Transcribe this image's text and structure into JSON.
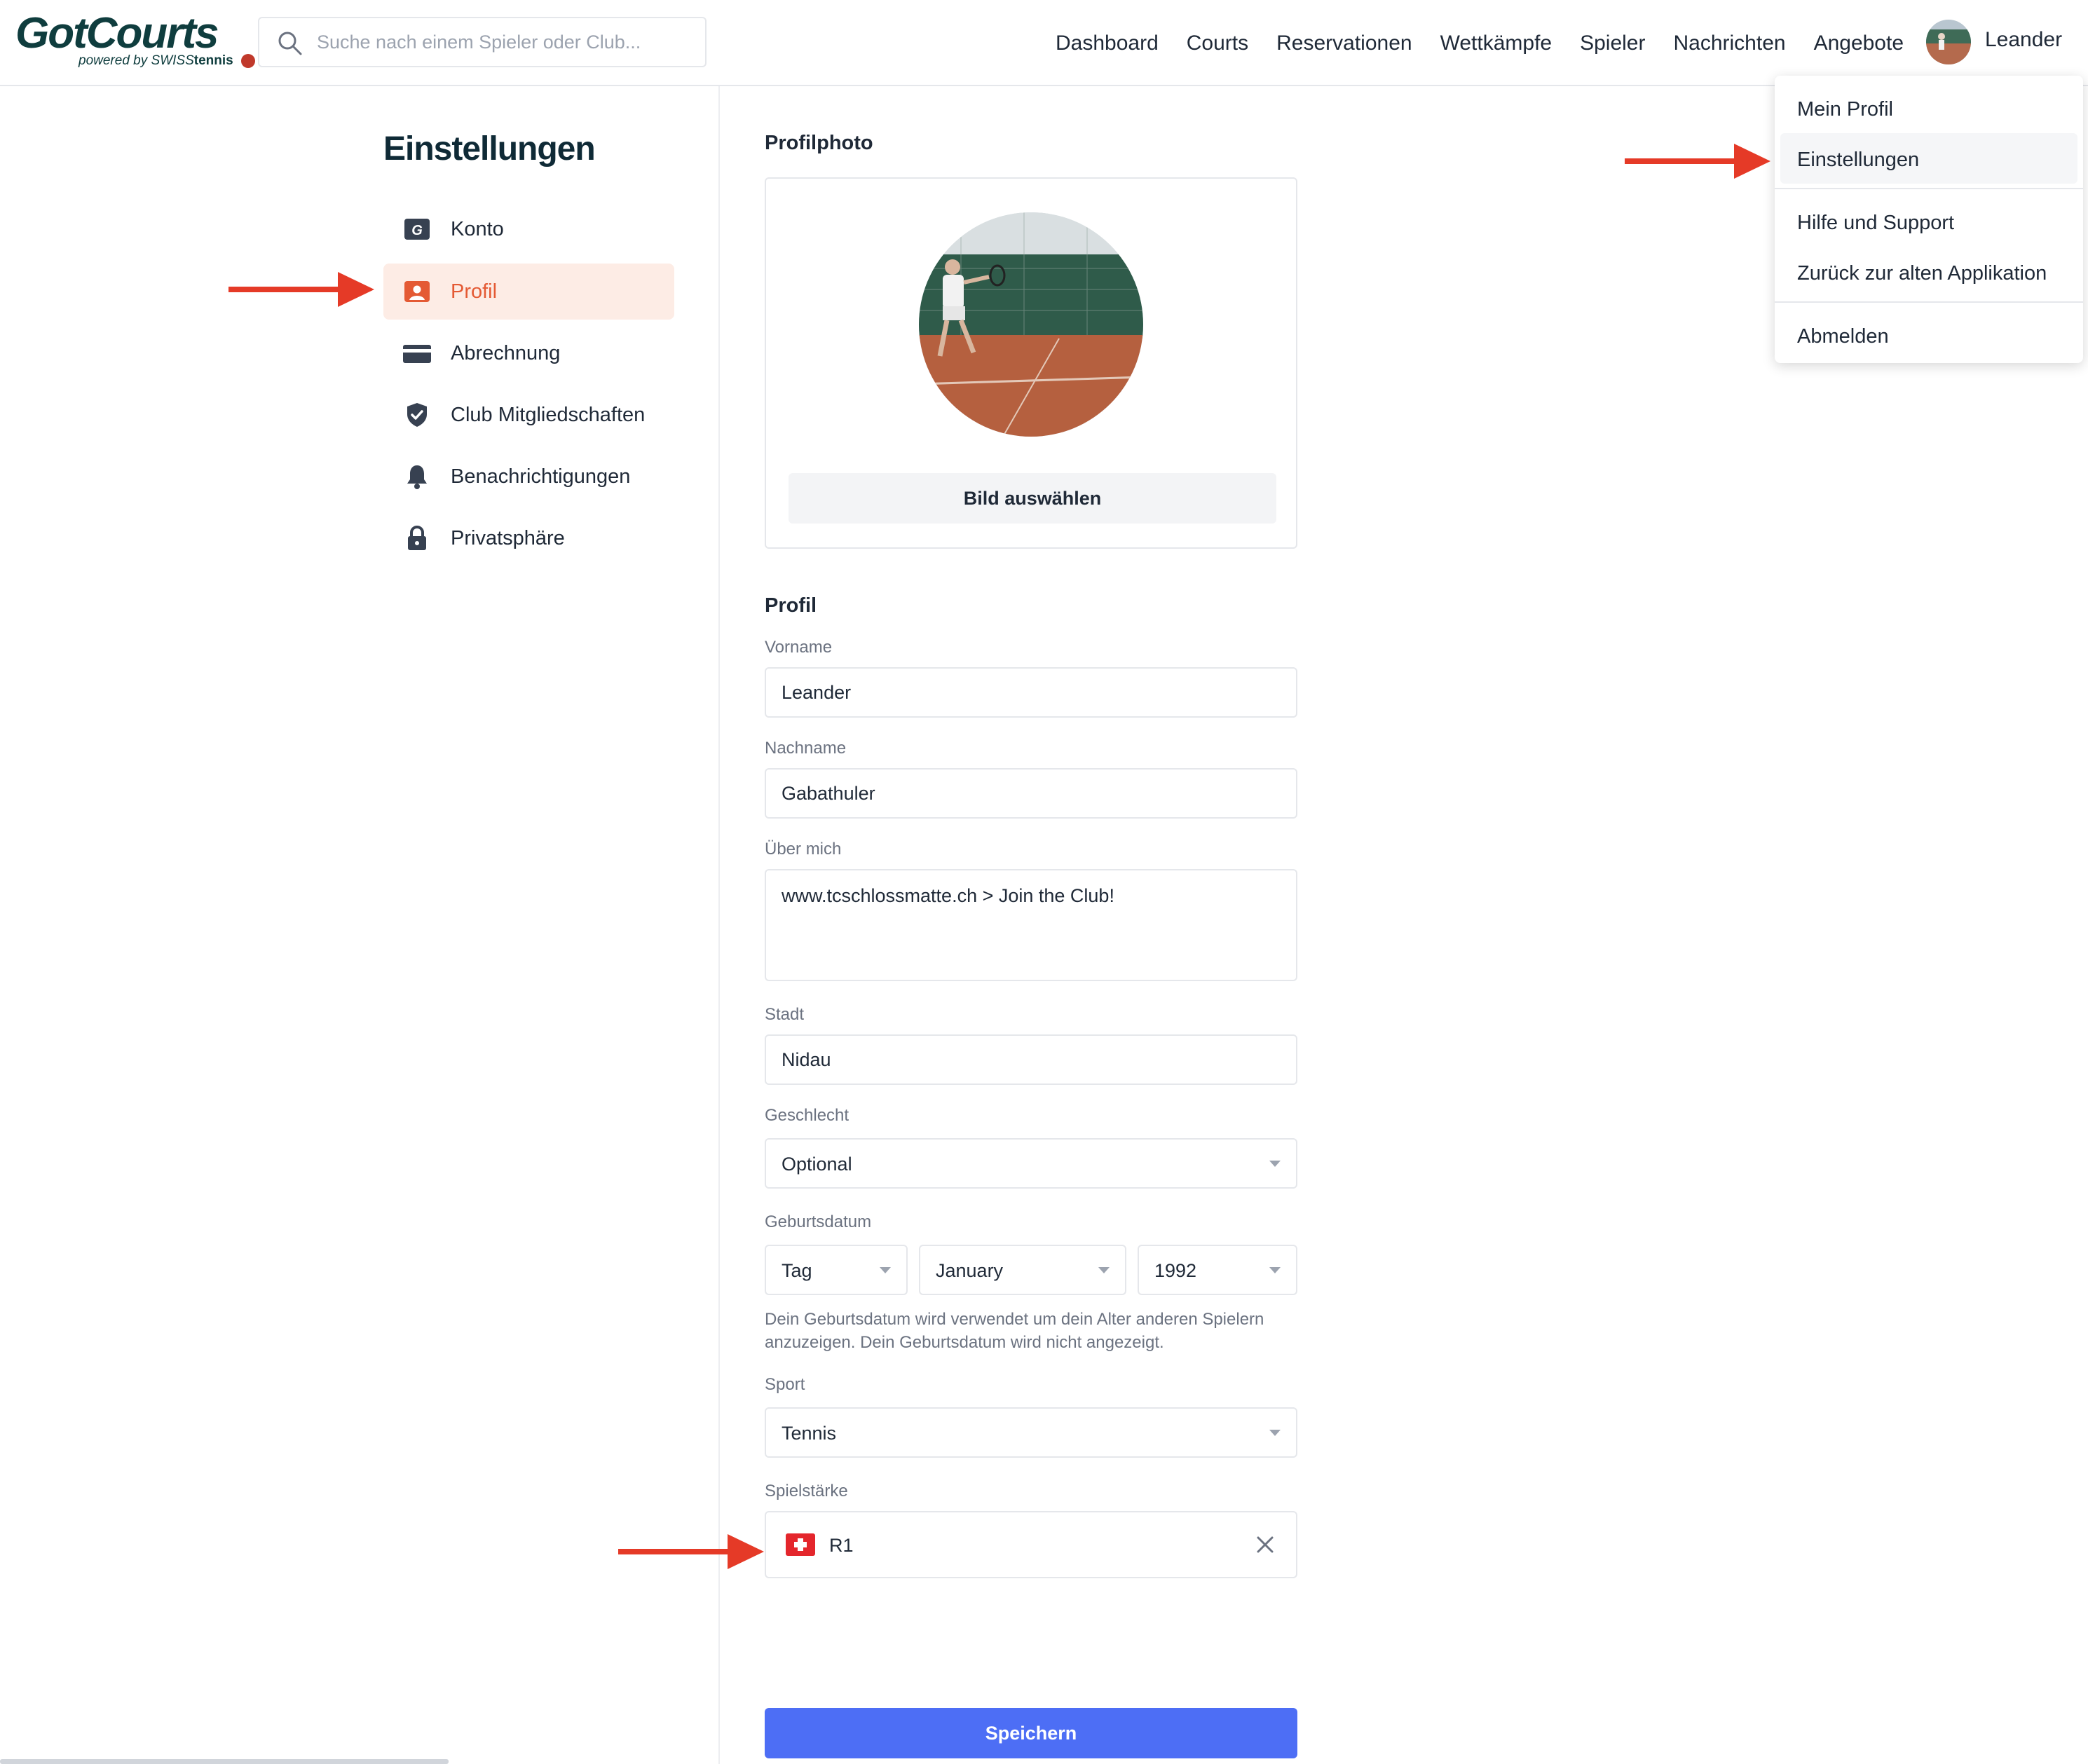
{
  "header": {
    "logo_text": "GotCourts",
    "logo_powered": "powered by",
    "logo_swiss": "SWISS",
    "logo_tennis": "tennis",
    "search_placeholder": "Suche nach einem Spieler oder Club...",
    "nav": [
      "Dashboard",
      "Courts",
      "Reservationen",
      "Wettkämpfe",
      "Spieler",
      "Nachrichten",
      "Angebote"
    ],
    "user_name": "Leander"
  },
  "sidebar": {
    "title": "Einstellungen",
    "items": [
      {
        "label": "Konto",
        "icon": "gotcourts-g-icon"
      },
      {
        "label": "Profil",
        "icon": "profile-card-icon",
        "active": true
      },
      {
        "label": "Abrechnung",
        "icon": "credit-card-icon"
      },
      {
        "label": "Club Mitgliedschaften",
        "icon": "shield-check-icon"
      },
      {
        "label": "Benachrichtigungen",
        "icon": "bell-icon"
      },
      {
        "label": "Privatsphäre",
        "icon": "lock-icon"
      }
    ]
  },
  "profile_photo": {
    "title": "Profilphoto",
    "button_label": "Bild auswählen"
  },
  "profile": {
    "title": "Profil",
    "first_name_label": "Vorname",
    "first_name_value": "Leander",
    "last_name_label": "Nachname",
    "last_name_value": "Gabathuler",
    "about_label": "Über mich",
    "about_value": "www.tcschlossmatte.ch > Join the Club!",
    "city_label": "Stadt",
    "city_value": "Nidau",
    "gender_label": "Geschlecht",
    "gender_value": "Optional",
    "birthdate_label": "Geburtsdatum",
    "birth_day": "Tag",
    "birth_month": "January",
    "birth_year": "1992",
    "birthdate_hint": "Dein Geburtsdatum wird verwendet um dein Alter anderen Spielern anzuzeigen. Dein Geburtsdatum wird nicht angezeigt.",
    "sport_label": "Sport",
    "sport_value": "Tennis",
    "level_label": "Spielstärke",
    "level_value": "R1",
    "save_label": "Speichern"
  },
  "user_menu": {
    "items": [
      "Mein Profil",
      "Einstellungen",
      "Hilfe und Support",
      "Zurück zur alten Applikation",
      "Abmelden"
    ],
    "highlighted": "Einstellungen"
  },
  "colors": {
    "accent": "#e45a34",
    "active_bg": "#fdece5",
    "primary_button": "#4d6ef5",
    "annotation_arrow": "#e53a27",
    "logo": "#0f3d3e"
  }
}
